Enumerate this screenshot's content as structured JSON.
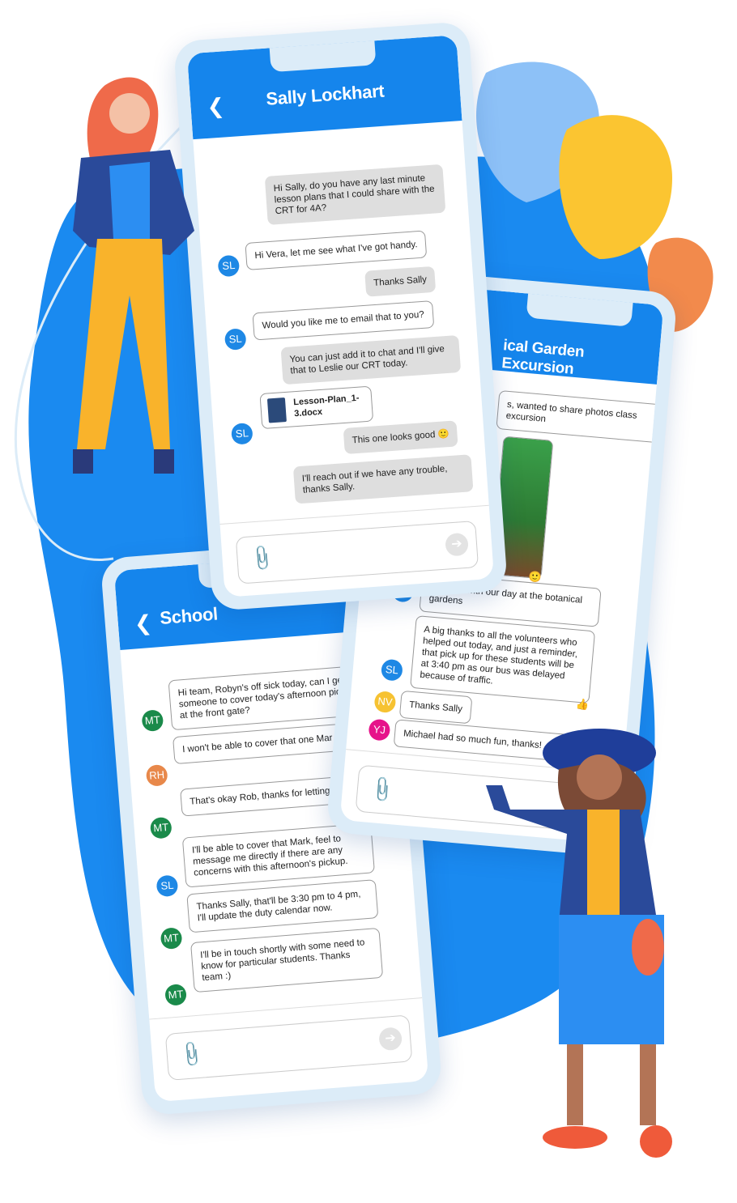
{
  "colors": {
    "brand": "#1585ec",
    "blob": "#1a8af0",
    "sl": "#1e88e5",
    "mt": "#1a8a4a",
    "rh": "#e8884a",
    "nv": "#f6c232",
    "yj": "#e6138a"
  },
  "phone_sally": {
    "title": "Sally Lockhart",
    "back_icon": "chevron-left",
    "messages": [
      {
        "from": "me",
        "text": "Hi Sally, do you have any last minute lesson plans that I could share with the CRT for 4A?"
      },
      {
        "from": "SL",
        "text": "Hi Vera, let me see what I've got handy."
      },
      {
        "from": "me",
        "text": "Thanks Sally"
      },
      {
        "from": "SL",
        "text": "Would you like me to email that to you?"
      },
      {
        "from": "me",
        "text": "You can just add it to chat and I'll give that to Leslie our CRT today."
      },
      {
        "from": "SL",
        "text": "Lesson-Plan_1-3.docx"
      },
      {
        "from": "me",
        "text": "This one looks good 🙂"
      },
      {
        "from": "me",
        "text": "I'll reach out if we have any trouble, thanks Sally."
      }
    ]
  },
  "phone_garden": {
    "title": "ical Garden Excursion",
    "messages": [
      {
        "from": "SL",
        "text": "s, wanted to share photos class excursion"
      },
      {
        "from": "SL",
        "text": "to assist with our day at the botanical gardens",
        "reaction": "🙂"
      },
      {
        "from": "SL",
        "text": "A big thanks to all the volunteers who helped out today, and just a reminder, that pick up for these students will be at 3:40 pm as our bus was delayed because of traffic.",
        "reaction": "👍"
      },
      {
        "from": "NV",
        "text": "Thanks Sally"
      },
      {
        "from": "YJ",
        "text": "Michael had so much fun, thanks!"
      }
    ]
  },
  "phone_school": {
    "title": "School",
    "messages": [
      {
        "from": "MT",
        "text": "Hi team, Robyn's off sick today, can I get someone to cover today's afternoon pick-up at the front gate?"
      },
      {
        "from": "RH",
        "text": "I won't be able to cover that one Mar sorry."
      },
      {
        "from": "MT",
        "text": "That's okay Rob, thanks for letting know."
      },
      {
        "from": "SL",
        "text": "I'll be able to cover that Mark, feel to message me directly if there are any concerns with this afternoon's pickup."
      },
      {
        "from": "MT",
        "text": "Thanks Sally, that'll be 3:30 pm to 4 pm, I'll update the duty calendar now."
      },
      {
        "from": "MT",
        "text": "I'll be in touch shortly with some need to know for particular students. Thanks team :)"
      }
    ]
  },
  "avatars": {
    "SL": "SL",
    "MT": "MT",
    "RH": "RH",
    "NV": "NV",
    "YJ": "YJ"
  }
}
